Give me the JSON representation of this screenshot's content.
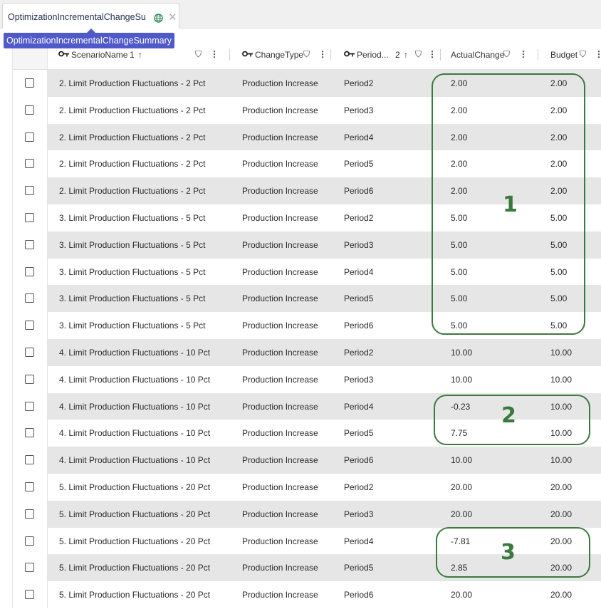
{
  "tab": {
    "title": "OptimizationIncrementalChangeSu",
    "tooltip": "OptimizationIncrementalChangeSummary"
  },
  "columns": {
    "scenario": {
      "label": "ScenarioName",
      "sort_index": "1",
      "sort_arrow": "↑"
    },
    "changetype": {
      "label": "ChangeType"
    },
    "period": {
      "label": "Period...",
      "sort_index": "2",
      "sort_arrow": "↑"
    },
    "actual": {
      "label": "ActualChange"
    },
    "budget": {
      "label": "Budget"
    }
  },
  "icons": {
    "key": "key-icon",
    "filter": "filter-icon",
    "menu": "kebab-menu-icon",
    "globe": "globe-icon",
    "close": "close-icon"
  },
  "rows": [
    {
      "scenario": "2. Limit Production Fluctuations - 2 Pct",
      "type": "Production Increase",
      "period": "Period2",
      "actual": "2.00",
      "budget": "2.00"
    },
    {
      "scenario": "2. Limit Production Fluctuations - 2 Pct",
      "type": "Production Increase",
      "period": "Period3",
      "actual": "2.00",
      "budget": "2.00"
    },
    {
      "scenario": "2. Limit Production Fluctuations - 2 Pct",
      "type": "Production Increase",
      "period": "Period4",
      "actual": "2.00",
      "budget": "2.00"
    },
    {
      "scenario": "2. Limit Production Fluctuations - 2 Pct",
      "type": "Production Increase",
      "period": "Period5",
      "actual": "2.00",
      "budget": "2.00"
    },
    {
      "scenario": "2. Limit Production Fluctuations - 2 Pct",
      "type": "Production Increase",
      "period": "Period6",
      "actual": "2.00",
      "budget": "2.00"
    },
    {
      "scenario": "3. Limit Production Fluctuations - 5 Pct",
      "type": "Production Increase",
      "period": "Period2",
      "actual": "5.00",
      "budget": "5.00"
    },
    {
      "scenario": "3. Limit Production Fluctuations - 5 Pct",
      "type": "Production Increase",
      "period": "Period3",
      "actual": "5.00",
      "budget": "5.00"
    },
    {
      "scenario": "3. Limit Production Fluctuations - 5 Pct",
      "type": "Production Increase",
      "period": "Period4",
      "actual": "5.00",
      "budget": "5.00"
    },
    {
      "scenario": "3. Limit Production Fluctuations - 5 Pct",
      "type": "Production Increase",
      "period": "Period5",
      "actual": "5.00",
      "budget": "5.00"
    },
    {
      "scenario": "3. Limit Production Fluctuations - 5 Pct",
      "type": "Production Increase",
      "period": "Period6",
      "actual": "5.00",
      "budget": "5.00"
    },
    {
      "scenario": "4. Limit Production Fluctuations - 10 Pct",
      "type": "Production Increase",
      "period": "Period2",
      "actual": "10.00",
      "budget": "10.00"
    },
    {
      "scenario": "4. Limit Production Fluctuations - 10 Pct",
      "type": "Production Increase",
      "period": "Period3",
      "actual": "10.00",
      "budget": "10.00"
    },
    {
      "scenario": "4. Limit Production Fluctuations - 10 Pct",
      "type": "Production Increase",
      "period": "Period4",
      "actual": "-0.23",
      "budget": "10.00"
    },
    {
      "scenario": "4. Limit Production Fluctuations - 10 Pct",
      "type": "Production Increase",
      "period": "Period5",
      "actual": "7.75",
      "budget": "10.00"
    },
    {
      "scenario": "4. Limit Production Fluctuations - 10 Pct",
      "type": "Production Increase",
      "period": "Period6",
      "actual": "10.00",
      "budget": "10.00"
    },
    {
      "scenario": "5. Limit Production Fluctuations - 20 Pct",
      "type": "Production Increase",
      "period": "Period2",
      "actual": "20.00",
      "budget": "20.00"
    },
    {
      "scenario": "5. Limit Production Fluctuations - 20 Pct",
      "type": "Production Increase",
      "period": "Period3",
      "actual": "20.00",
      "budget": "20.00"
    },
    {
      "scenario": "5. Limit Production Fluctuations - 20 Pct",
      "type": "Production Increase",
      "period": "Period4",
      "actual": "-7.81",
      "budget": "20.00"
    },
    {
      "scenario": "5. Limit Production Fluctuations - 20 Pct",
      "type": "Production Increase",
      "period": "Period5",
      "actual": "2.85",
      "budget": "20.00"
    },
    {
      "scenario": "5. Limit Production Fluctuations - 20 Pct",
      "type": "Production Increase",
      "period": "Period6",
      "actual": "20.00",
      "budget": "20.00"
    }
  ],
  "annotations": [
    {
      "label": "1"
    },
    {
      "label": "2"
    },
    {
      "label": "3"
    }
  ],
  "colors": {
    "annotation": "#3a7a3e",
    "tooltip_bg": "#5059c9",
    "row_alt": "#e6e6e6"
  }
}
